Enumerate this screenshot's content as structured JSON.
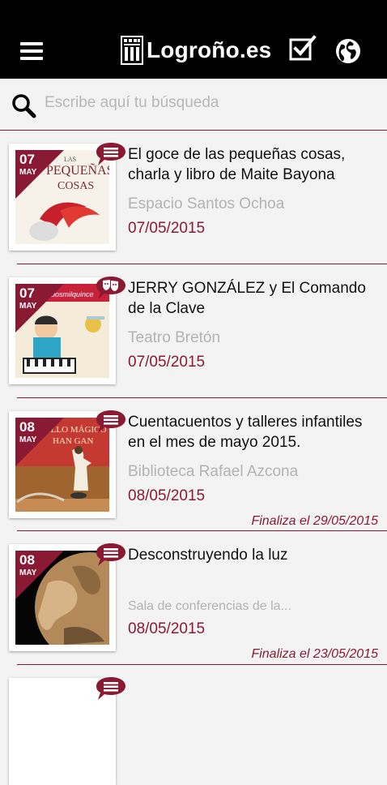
{
  "header": {
    "brand": "Logroño.es",
    "icons": [
      "menu-icon",
      "logo-castle-icon",
      "checkbox-icon",
      "globe-icon"
    ]
  },
  "search": {
    "placeholder": "Escribe aquí tu búsqueda",
    "value": ""
  },
  "colors": {
    "accent": "#8a1a34",
    "topbar": "#000000",
    "muted": "#b3b3b3"
  },
  "events": [
    {
      "day": "07",
      "month": "MAY",
      "title": "El goce de las pequeñas cosas, charla y libro de Maite Bayona",
      "venue": "Espacio Santos Ochoa",
      "date": "07/05/2015",
      "ends": "",
      "category_icon": "list-icon",
      "image_text_lines": [
        "LAS",
        "PEQUEÑAS",
        "COSAS"
      ]
    },
    {
      "day": "07",
      "month": "MAY",
      "title": "JERRY GONZÁLEZ y El Comando de la Clave",
      "venue": "Teatro Bretón",
      "date": "07/05/2015",
      "ends": "",
      "category_icon": "theater-masks-icon",
      "image_text_lines": [
        "dosmilquince"
      ]
    },
    {
      "day": "08",
      "month": "MAY",
      "title": "Cuentacuentos y talleres infantiles en el mes de mayo 2015.",
      "venue": "Biblioteca Rafael Azcona",
      "date": "08/05/2015",
      "ends": "Finaliza el 29/05/2015",
      "category_icon": "list-icon",
      "image_text_lines": [
        "ILLO MÁGICO",
        "HAN GAN"
      ]
    },
    {
      "day": "08",
      "month": "MAY",
      "title": "Desconstruyendo la luz",
      "venue": "Sala de conferencias de la...",
      "date": "08/05/2015",
      "ends": "Finaliza el 23/05/2015",
      "category_icon": "list-icon",
      "image_text_lines": []
    },
    {
      "category_icon": "list-icon"
    }
  ]
}
